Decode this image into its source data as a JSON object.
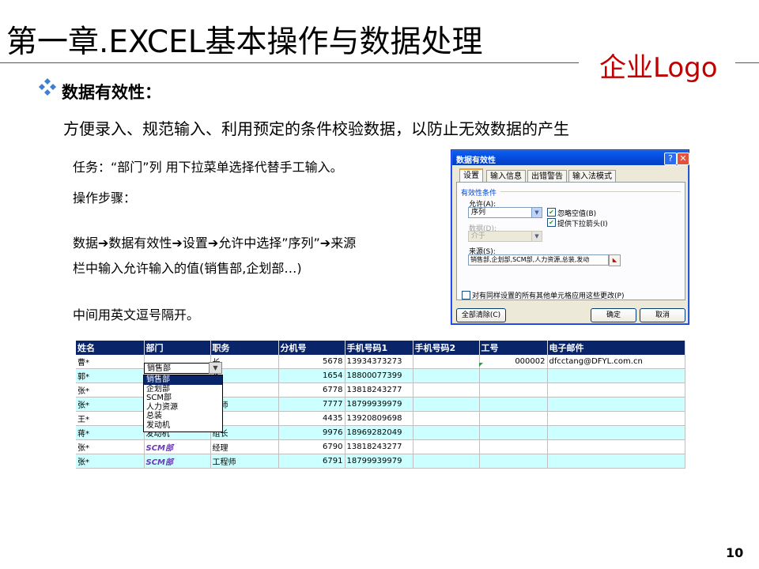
{
  "slide": {
    "title": "第一章.EXCEL基本操作与数据处理",
    "logo": "企业Logo",
    "logo_color": "#c00000",
    "section_heading": "数据有效性：",
    "intro": "方便录入、规范输入、利用预定的条件校验数据，以防止无效数据的产生",
    "task": "任务：“部门”列 用下拉菜单选择代替手工输入。",
    "steps_label": "操作步骤：",
    "steps_line1": "数据➔数据有效性➔设置➔允许中选择”序列”➔来源",
    "steps_line2": "栏中输入允许输入的值(销售部,企划部…)",
    "note": "中间用英文逗号隔开。",
    "page_number": "10"
  },
  "dialog": {
    "title": "数据有效性",
    "help_button": "?",
    "close_button": "✕",
    "tabs": [
      "设置",
      "输入信息",
      "出错警告",
      "输入法模式"
    ],
    "active_tab": "设置",
    "group_label": "有效性条件",
    "allow_label": "允许(A):",
    "allow_value": "序列",
    "data_label": "数据(D):",
    "data_value": "介于",
    "ignore_blank_label": "忽略空值(B)",
    "dropdown_label": "提供下拉箭头(I)",
    "source_label": "来源(S):",
    "source_value": "销售部,企划部,SCM部,人力资源,总装,发动",
    "apply_all_label": "对有同样设置的所有其他单元格应用这些更改(P)",
    "clear_button": "全部清除(C)",
    "ok_button": "确定",
    "cancel_button": "取消"
  },
  "sheet": {
    "columns": [
      "姓名",
      "部门",
      "职务",
      "分机号",
      "手机号码1",
      "手机号码2",
      "工号",
      "电子邮件"
    ],
    "rows": [
      [
        "曹*",
        "",
        "长",
        "5678",
        "13934373273",
        "",
        "000002",
        "dfcctang@DFYL.com.cn"
      ],
      [
        "郭*",
        "",
        "长",
        "1654",
        "18800077399",
        "",
        "",
        ""
      ],
      [
        "张*",
        "",
        "理",
        "6778",
        "13818243277",
        "",
        "",
        ""
      ],
      [
        "张*",
        "",
        "程师",
        "7777",
        "18799939979",
        "",
        "",
        ""
      ],
      [
        "王*",
        "",
        "长",
        "4435",
        "13920809698",
        "",
        "",
        ""
      ],
      [
        "蒋*",
        "发动机",
        "组长",
        "9976",
        "18969282049",
        "",
        "",
        ""
      ],
      [
        "张*",
        "SCM部",
        "经理",
        "6790",
        "13818243277",
        "",
        "",
        ""
      ],
      [
        "张*",
        "SCM部",
        "工程师",
        "6791",
        "18799939979",
        "",
        "",
        ""
      ]
    ],
    "active_cell_value": "销售部",
    "dropdown_options": [
      "销售部",
      "企划部",
      "SCM部",
      "人力资源",
      "总装",
      "发动机"
    ],
    "selected_option": "销售部",
    "header_color": "#0a246a",
    "row_color": "#ccffff"
  }
}
